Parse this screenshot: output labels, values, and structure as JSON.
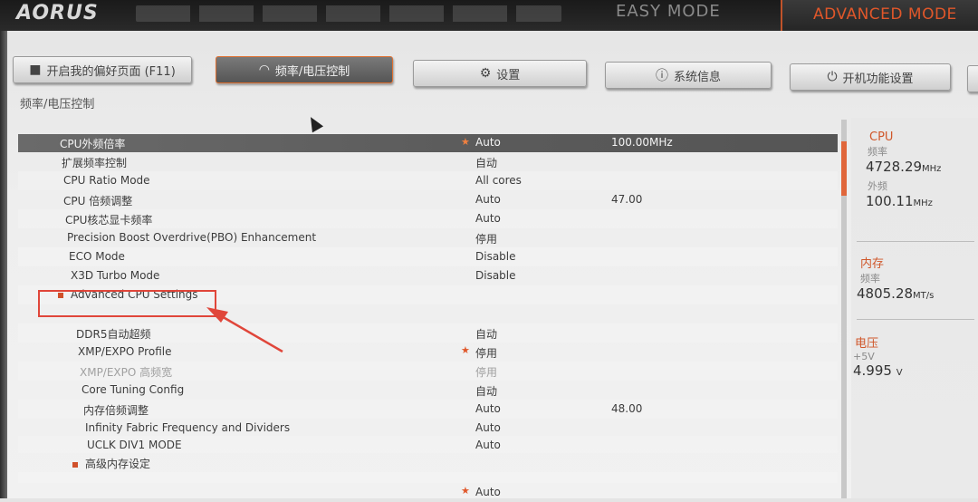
{
  "brand": {
    "logo": "AORUS"
  },
  "mode": {
    "easy": "EASY MODE",
    "advanced": "ADVANCED MODE"
  },
  "tabs": [
    {
      "label": "开启我的偏好页面 (F11)",
      "icon": "star-page-icon"
    },
    {
      "label": "频率/电压控制",
      "icon": "gauge-icon"
    },
    {
      "label": "设置",
      "icon": "gear-icon"
    },
    {
      "label": "系统信息",
      "icon": "info-icon"
    },
    {
      "label": "开机功能设置",
      "icon": "power-icon"
    }
  ],
  "breadcrumb": "频率/电压控制",
  "rows": [
    {
      "label": "CPU外频倍率",
      "value": "Auto",
      "value2": "100.00MHz",
      "star": "★"
    },
    {
      "label": "扩展频率控制",
      "value": "自动"
    },
    {
      "label": "CPU Ratio Mode",
      "value": "All cores"
    },
    {
      "label": "CPU 倍频调整",
      "value": "Auto",
      "value2": "47.00"
    },
    {
      "label": "CPU核芯显卡频率",
      "value": "Auto"
    },
    {
      "label": "Precision Boost Overdrive(PBO) Enhancement",
      "value": "停用"
    },
    {
      "label": "ECO Mode",
      "value": "Disable"
    },
    {
      "label": "X3D Turbo Mode",
      "value": "Disable"
    },
    {
      "label": "Advanced CPU Settings"
    },
    {
      "label": "DDR5自动超频",
      "value": "自动"
    },
    {
      "label": "XMP/EXPO Profile",
      "value": "停用",
      "star": "★"
    },
    {
      "label": "XMP/EXPO 高频宽",
      "value": "停用"
    },
    {
      "label": "Core Tuning Config",
      "value": "自动"
    },
    {
      "label": "内存倍频调整",
      "value": "Auto",
      "value2": "48.00"
    },
    {
      "label": "Infinity Fabric Frequency and Dividers",
      "value": "Auto"
    },
    {
      "label": "UCLK DIV1 MODE",
      "value": "Auto"
    },
    {
      "label": "高级内存设定"
    },
    {
      "label": "",
      "value": "Auto",
      "star": "★"
    }
  ],
  "monitor": {
    "cpu": {
      "title": "CPU",
      "freq_label": "频率",
      "freq": "4728.29",
      "freq_unit": "MHz",
      "bclk_label": "外频",
      "bclk": "100.11",
      "bclk_unit": "MHz"
    },
    "memory": {
      "title": "内存",
      "freq_label": "频率",
      "freq": "4805.28",
      "freq_unit": "MT/s"
    },
    "voltage": {
      "title": "电压",
      "rail_label": "+5V",
      "rail": "4.995",
      "rail_unit": "V"
    }
  },
  "colors": {
    "accent": "#e0572a",
    "highlight_box": "#e0463a"
  }
}
